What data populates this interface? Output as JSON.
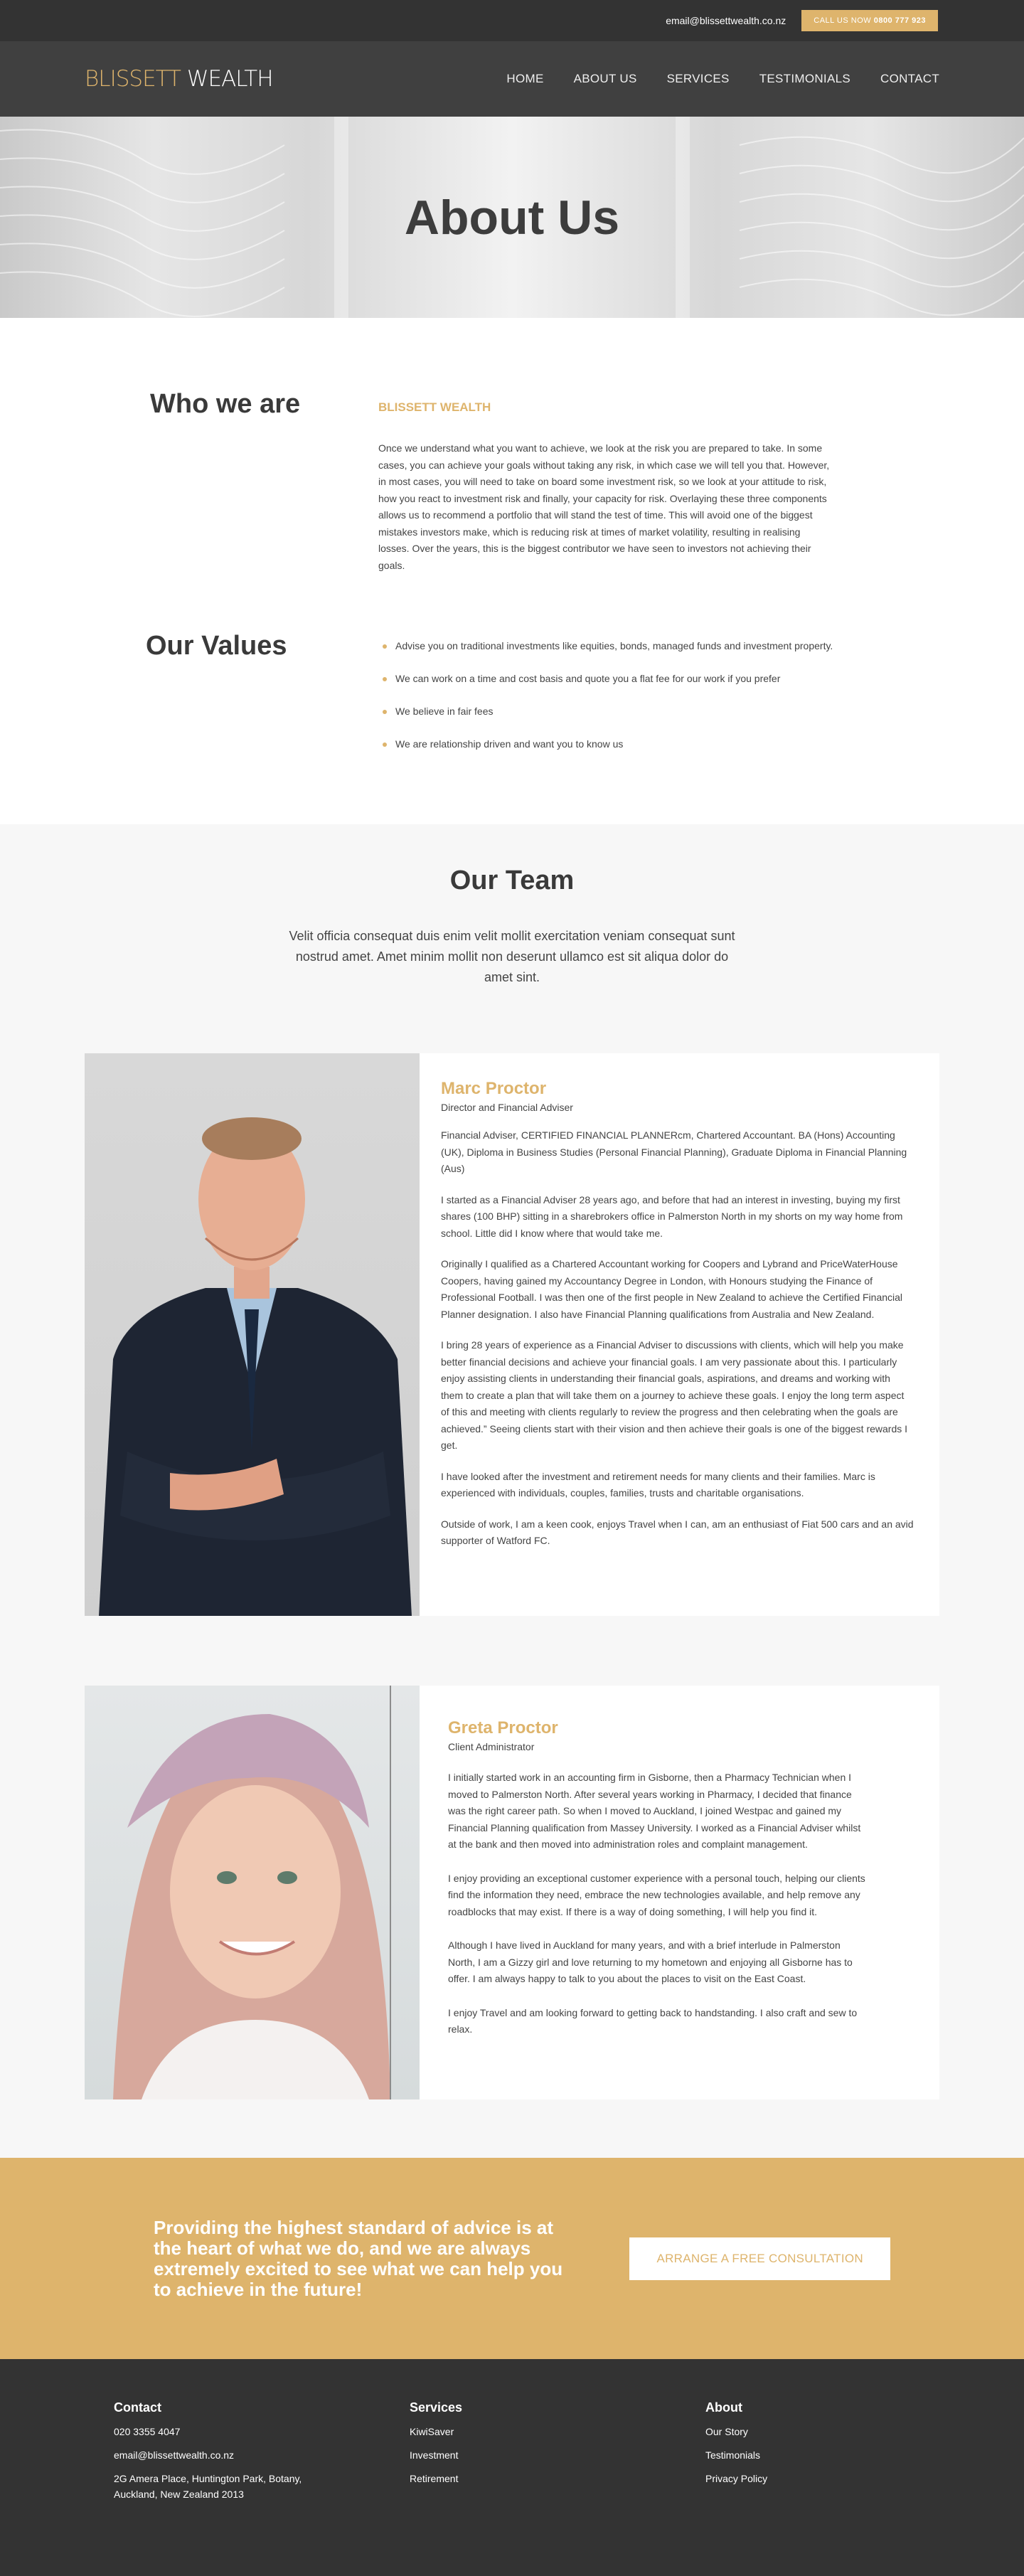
{
  "topbar": {
    "email": "email@blissettwealth.co.nz",
    "call_prefix": "CALL US NOW",
    "call_number": "0800 777 923"
  },
  "nav": {
    "logo_part1": "BLISSETT",
    "logo_part2": "WEALTH",
    "items": [
      "HOME",
      "ABOUT US",
      "SERVICES",
      "TESTIMONIALS",
      "CONTACT"
    ]
  },
  "hero": {
    "title": "About Us"
  },
  "who": {
    "heading": "Who we are",
    "label": "BLISSETT WEALTH",
    "text": "Once we understand what you want to achieve, we look at the risk you are prepared to take. In some cases, you can achieve your goals without taking any risk, in which case we will tell you that. However, in most cases, you will need to take on board some investment risk, so we look at your attitude to risk, how you react to investment risk and finally, your capacity for risk. Overlaying these three components allows us to recommend a portfolio that will stand the test of time. This will avoid one of the biggest mistakes investors make, which is reducing risk at times of market volatility, resulting in realising losses. Over the years, this is the biggest contributor we have seen to investors not achieving their goals."
  },
  "values": {
    "heading": "Our Values",
    "items": [
      "Advise you on traditional investments like equities, bonds, managed funds and investment property.",
      "We can work on a time and cost basis and quote you a flat fee for our work if you prefer",
      "We believe in fair fees",
      "We are relationship driven and want you to know us"
    ]
  },
  "team": {
    "heading": "Our Team",
    "intro": "Velit officia consequat duis enim velit mollit exercitation veniam consequat sunt nostrud amet. Amet minim mollit non deserunt ullamco est sit aliqua dolor do amet sint.",
    "members": [
      {
        "name": "Marc Proctor",
        "role": "Director and Financial Adviser",
        "bio": [
          "Financial Adviser, CERTIFIED FINANCIAL PLANNERcm, Chartered Accountant. BA (Hons) Accounting (UK), Diploma in Business Studies (Personal Financial Planning), Graduate Diploma in Financial Planning (Aus)",
          "I started as a Financial Adviser 28 years ago, and before that had an interest in investing, buying my first shares (100 BHP) sitting in a sharebrokers office in Palmerston North in my shorts on my way home from school. Little did I know where that would take me.",
          "Originally I qualified as a Chartered Accountant working for Coopers and Lybrand and PriceWaterHouse Coopers, having gained my Accountancy Degree in London, with Honours studying the Finance of Professional Football. I was then one of the first people in New Zealand to achieve the Certified Financial Planner designation. I also have Financial Planning qualifications from Australia and New Zealand.",
          "I bring 28 years of experience as a Financial Adviser to discussions with clients, which will help you make better financial decisions and achieve your financial goals. I am very passionate about this. I particularly enjoy assisting clients in understanding their financial goals, aspirations, and dreams and working with them to create a plan that will take them on a journey to achieve these goals. I enjoy the long term aspect of this and meeting with clients regularly to review the progress and then celebrating when the goals are achieved.” Seeing clients start with their vision and then achieve their goals is one of the biggest rewards I get.",
          "I have looked after the investment and retirement needs for many clients and their families. Marc is experienced with individuals, couples, families, trusts and charitable organisations.",
          "Outside of work, I am a keen cook, enjoys Travel when I can, am an enthusiast of Fiat 500 cars and an avid supporter of Watford FC."
        ]
      },
      {
        "name": "Greta Proctor",
        "role": "Client Administrator",
        "bio": [
          "I initially started work in an accounting firm in Gisborne, then a Pharmacy Technician when I moved to Palmerston North. After several years working in Pharmacy, I decided that finance was the right career path. So when I moved to Auckland, I joined Westpac and gained my Financial Planning qualification from Massey University. I worked as a Financial Adviser whilst at the bank and then moved into administration roles and complaint management.",
          "I enjoy providing an exceptional customer experience with a personal touch, helping our clients find the information they need, embrace the new technologies available, and help remove any roadblocks that may exist. If there is a way of doing something, I will help you find it.",
          "Although I have lived in Auckland for many years, and with a brief interlude in Palmerston North, I am a Gizzy girl and love returning to my hometown and enjoying all Gisborne has to offer. I am always happy to talk to you about the places to visit on the East Coast.",
          "I enjoy Travel and am looking forward to getting back to handstanding. I also craft and sew to relax."
        ]
      }
    ]
  },
  "cta": {
    "text": "Providing the highest standard of advice is at the heart of what we do, and we are always extremely excited to see what we can help you to achieve in the future!",
    "button": "ARRANGE A FREE CONSULTATION"
  },
  "footer": {
    "contact": {
      "heading": "Contact",
      "phone": "020 3355 4047",
      "email": "email@blissettwealth.co.nz",
      "address": "2G Amera Place, Huntington Park, Botany, Auckland, New Zealand 2013"
    },
    "services": {
      "heading": "Services",
      "items": [
        "KiwiSaver",
        "Investment",
        "Retirement"
      ]
    },
    "about": {
      "heading": "About",
      "items": [
        "Our Story",
        "Testimonials",
        "Privacy Policy"
      ]
    }
  },
  "colors": {
    "accent": "#deb46c",
    "dark": "#333333",
    "nav": "#404040"
  }
}
